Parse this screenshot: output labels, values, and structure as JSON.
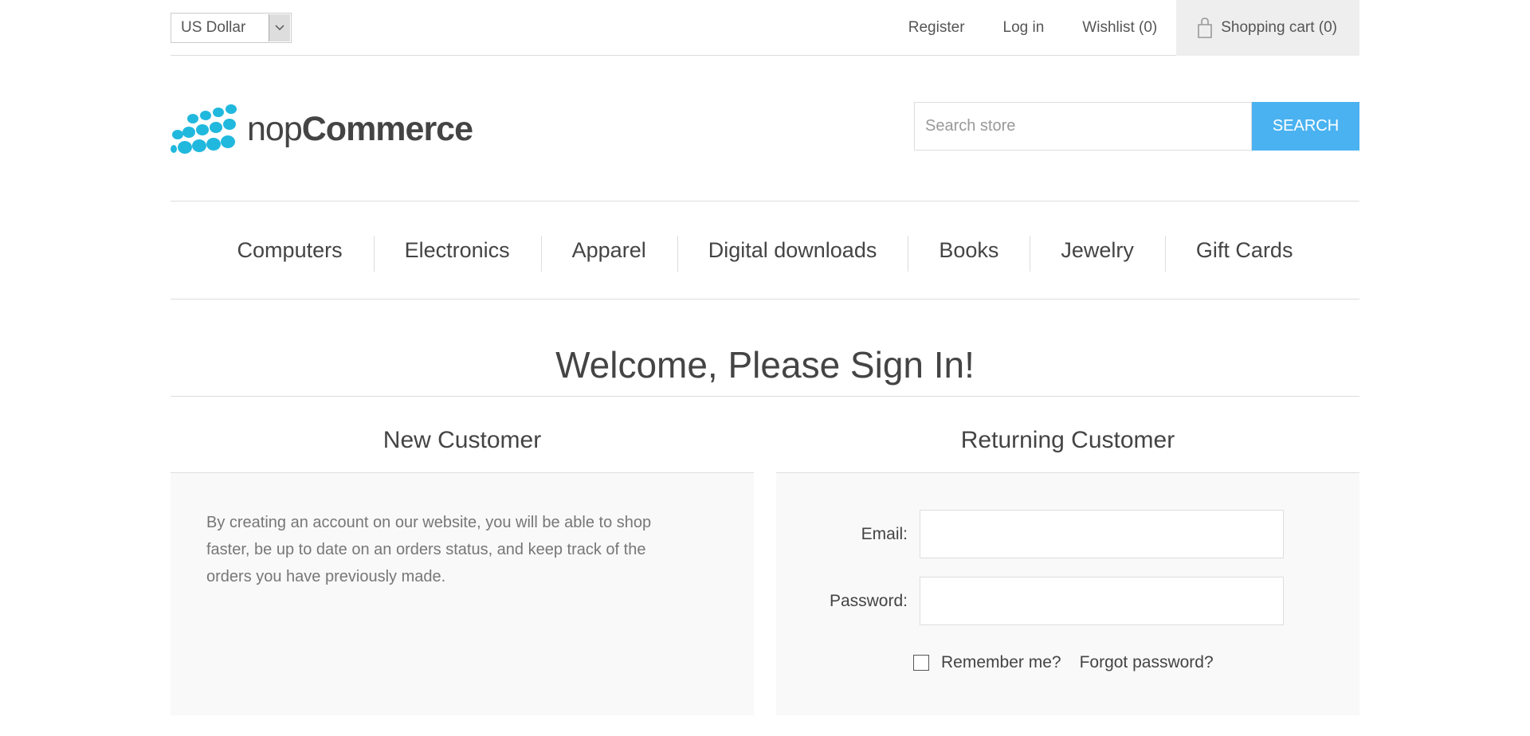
{
  "header": {
    "currency": {
      "selected": "US Dollar"
    },
    "links": {
      "register": "Register",
      "login": "Log in",
      "wishlist": "Wishlist (0)",
      "cart": "Shopping cart (0)"
    }
  },
  "logo": {
    "part1": "nop",
    "part2": "Commerce"
  },
  "search": {
    "placeholder": "Search store",
    "button": "SEARCH"
  },
  "menu": {
    "items": [
      "Computers",
      "Electronics",
      "Apparel",
      "Digital downloads",
      "Books",
      "Jewelry",
      "Gift Cards"
    ]
  },
  "page": {
    "title": "Welcome, Please Sign In!"
  },
  "new_customer": {
    "title": "New Customer",
    "text": "By creating an account on our website, you will be able to shop faster, be up to date on an orders status, and keep track of the orders you have previously made."
  },
  "returning_customer": {
    "title": "Returning Customer",
    "email_label": "Email:",
    "email_value": "",
    "password_label": "Password:",
    "password_value": "",
    "remember_label": "Remember me?",
    "remember_checked": false,
    "forgot_label": "Forgot password?"
  },
  "colors": {
    "accent": "#4ab2f1",
    "logo_dots": "#21b8de",
    "panel_bg": "#f9f9f9",
    "cart_bg": "#eeeeee"
  },
  "icons": {
    "currency_dropdown": "chevron-down-icon",
    "cart": "shopping-bag-icon",
    "logo": "dots-logo-icon"
  }
}
